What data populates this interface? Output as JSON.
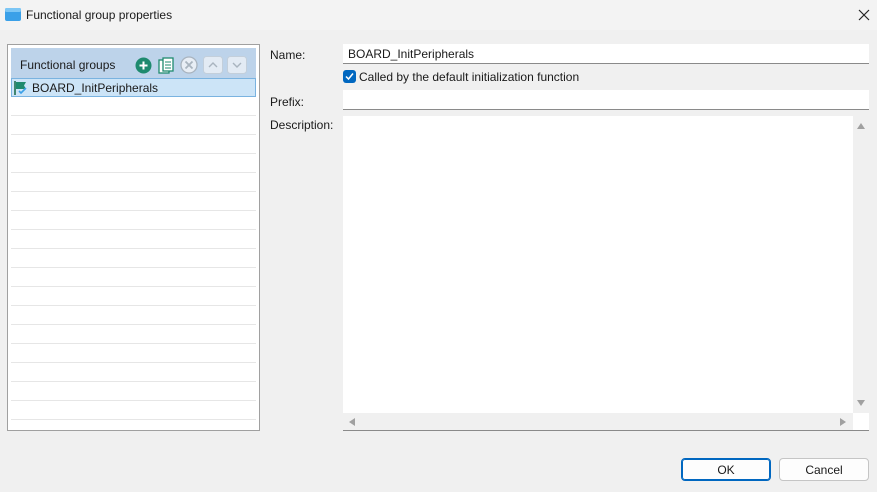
{
  "window": {
    "title": "Functional group properties",
    "app_icon": "folder-icon",
    "close_icon": "close-icon"
  },
  "functional_groups": {
    "header_label": "Functional groups",
    "toolbar": [
      {
        "name": "add-group-button",
        "icon": "plus-circle-icon",
        "enabled": true
      },
      {
        "name": "copy-group-button",
        "icon": "copy-icon",
        "enabled": true
      },
      {
        "name": "remove-group-button",
        "icon": "remove-circle-icon",
        "enabled": false
      },
      {
        "name": "move-up-button",
        "icon": "chevron-up-icon",
        "enabled": false
      },
      {
        "name": "move-down-button",
        "icon": "chevron-down-icon",
        "enabled": false
      }
    ],
    "items": [
      {
        "label": "BOARD_InitPeripherals",
        "icon": "functional-group-flag-icon",
        "selected": true
      }
    ]
  },
  "form": {
    "name_label": "Name:",
    "name_value": "BOARD_InitPeripherals",
    "default_init_checked": true,
    "default_init_label": "Called by the default initialization function",
    "prefix_label": "Prefix:",
    "prefix_value": "",
    "description_label": "Description:",
    "description_value": ""
  },
  "buttons": {
    "ok": "OK",
    "cancel": "Cancel"
  },
  "colors": {
    "accent": "#0067c0",
    "header_bg": "#bdd3ea",
    "selected_row": "#cce4f7",
    "add_icon": "#1e8a6e"
  }
}
